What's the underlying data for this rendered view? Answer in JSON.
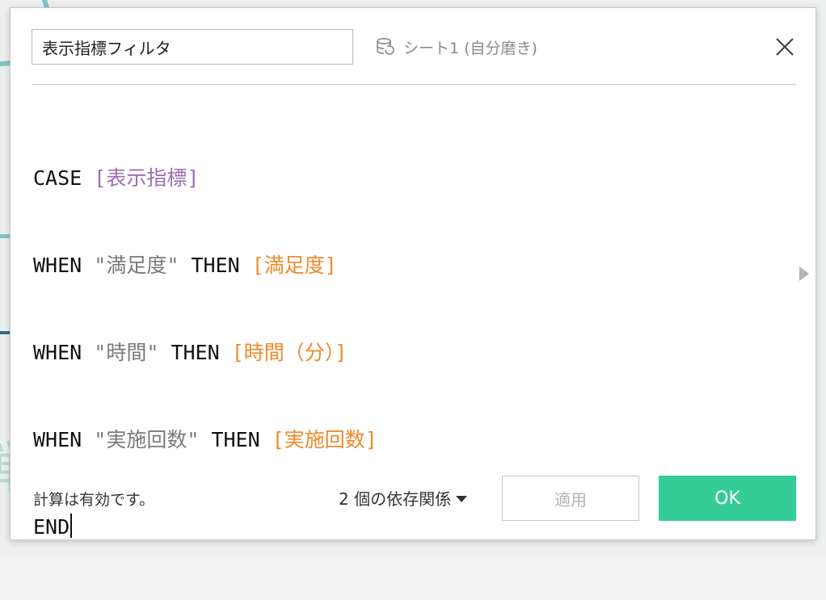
{
  "dialog": {
    "calc_name": "表示指標フィルタ",
    "datasource": "シート1 (自分磨き)",
    "icons": {
      "datasource": "database-icon",
      "close": "close-icon",
      "expand": "chevron-right-icon"
    }
  },
  "code": {
    "line1": {
      "kw": "CASE",
      "field": "[表示指標]"
    },
    "line2": {
      "kw": "WHEN",
      "str": "\"満足度\"",
      "kw2": "THEN",
      "field": "[満足度]"
    },
    "line3": {
      "kw": "WHEN",
      "str": "\"時間\"",
      "kw2": "THEN",
      "field": "[時間（分）]"
    },
    "line4": {
      "kw": "WHEN",
      "str": "\"実施回数\"",
      "kw2": "THEN",
      "field": "[実施回数]"
    },
    "line5": {
      "kw": "END"
    }
  },
  "footer": {
    "status": "計算は有効です。",
    "dependencies": "2 個の依存関係",
    "apply_label": "適用",
    "ok_label": "OK"
  },
  "colors": {
    "accent": "#35cc98",
    "field_purple": "#9a6db5",
    "field_orange": "#f08a2c"
  }
}
